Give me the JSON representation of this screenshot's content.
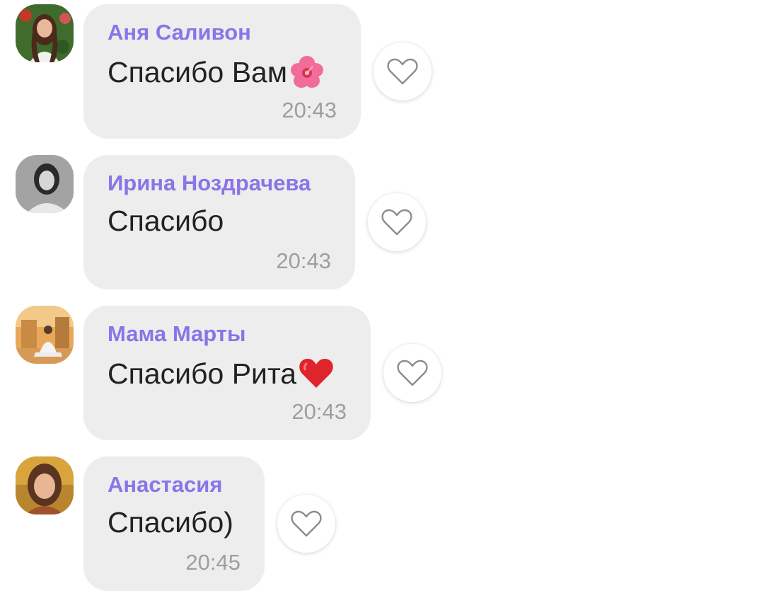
{
  "messages": [
    {
      "sender": "Аня Саливон",
      "text": "Спасибо Вам",
      "emoji": "hibiscus-emoji",
      "time": "20:43"
    },
    {
      "sender": "Ирина Ноздрачева",
      "text": "Спасибо",
      "emoji": "",
      "time": "20:43"
    },
    {
      "sender": "Мама Марты",
      "text": "Спасибо Рита",
      "emoji": "red-heart-emoji",
      "time": "20:43"
    },
    {
      "sender": "Анастасия",
      "text": "Спасибо)",
      "emoji": "",
      "time": "20:45"
    }
  ],
  "colors": {
    "sender_name": "#8a74e8",
    "bubble_bg": "#ededed",
    "message_text": "#222222",
    "timestamp": "#9e9e9e"
  },
  "icons": {
    "like": "heart-outline-icon"
  }
}
